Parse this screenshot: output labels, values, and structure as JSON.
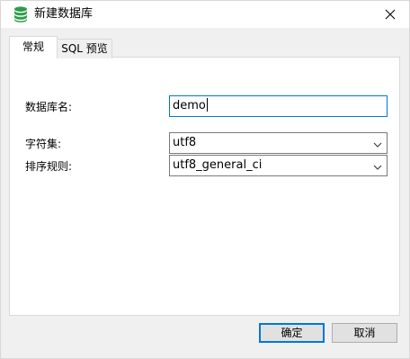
{
  "window": {
    "title": "新建数据库"
  },
  "tabs": [
    {
      "label": "常规",
      "active": true
    },
    {
      "label": "SQL 预览",
      "active": false
    }
  ],
  "form": {
    "db_name_label": "数据库名:",
    "db_name_value": "demo",
    "charset_label": "字符集:",
    "charset_value": "utf8",
    "collation_label": "排序规则:",
    "collation_value": "utf8_general_ci"
  },
  "buttons": {
    "ok_label": "确定",
    "cancel_label": "取消"
  },
  "icons": {
    "title": "database-icon",
    "close": "close-icon",
    "dropdown": "chevron-down-icon"
  },
  "colors": {
    "accent": "#0078d7",
    "db_icon": "#2e9d4a"
  }
}
